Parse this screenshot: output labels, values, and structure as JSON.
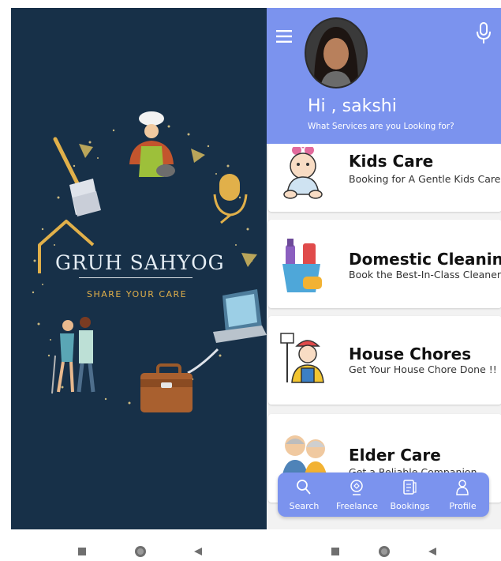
{
  "splash": {
    "brand_name": "GRUH SAHYOG",
    "tagline": "SHARE YOUR CARE",
    "colors": {
      "background": "#173048",
      "accent": "#e1b04a"
    }
  },
  "header": {
    "greeting": "Hi , sakshi",
    "subtitle": "What Services are you Looking for?",
    "menu_icon": "menu-icon",
    "mic_icon": "microphone-icon",
    "color": "#7b93ee"
  },
  "services": [
    {
      "title": "Kids Care",
      "description": "Booking for A Gentle Kids Care",
      "icon": "baby-icon"
    },
    {
      "title": "Domestic Cleaning",
      "description": "Book the Best-In-Class Cleaner",
      "icon": "cleaning-supplies-icon"
    },
    {
      "title": "House Chores",
      "description": "Get Your House Chore Done !!",
      "icon": "handyman-icon"
    },
    {
      "title": "Elder Care",
      "description": "Get a Reliable Companion",
      "icon": "elderly-couple-icon"
    }
  ],
  "bottom_nav": [
    {
      "label": "Search",
      "icon": "search-icon",
      "active": true
    },
    {
      "label": "Freelance",
      "icon": "freelance-icon",
      "active": false
    },
    {
      "label": "Bookings",
      "icon": "bookings-icon",
      "active": false
    },
    {
      "label": "Profile",
      "icon": "profile-icon",
      "active": false
    }
  ],
  "system_nav": [
    "recents-button",
    "home-button",
    "back-button"
  ]
}
